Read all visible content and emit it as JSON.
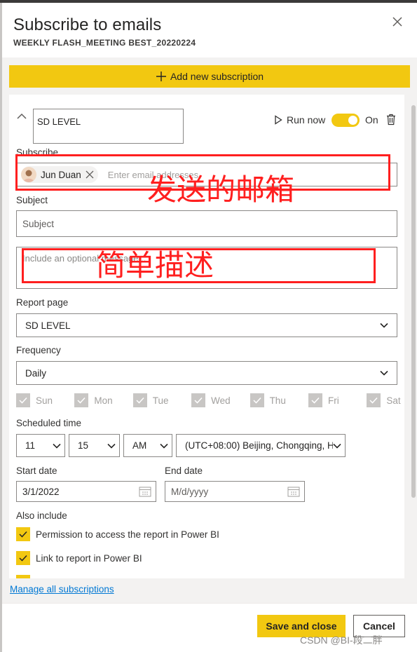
{
  "panel": {
    "title": "Subscribe to emails",
    "subtitle": "WEEKLY FLASH_MEETING BEST_20220224"
  },
  "add_subscription_label": "Add new subscription",
  "subscription": {
    "name": "SD LEVEL",
    "run_now_label": "Run now",
    "toggle_label": "On",
    "toggle_on": true,
    "subscribe_label": "Subscribe",
    "recipient_name": "Jun Duan",
    "email_placeholder": "Enter email addresses",
    "subject_label": "Subject",
    "subject_placeholder": "Subject",
    "message_placeholder": "Include an optional message...",
    "report_page_label": "Report page",
    "report_page_value": "SD LEVEL",
    "frequency_label": "Frequency",
    "frequency_value": "Daily",
    "days": [
      "Sun",
      "Mon",
      "Tue",
      "Wed",
      "Thu",
      "Fri",
      "Sat"
    ],
    "scheduled_time_label": "Scheduled time",
    "hour": "11",
    "minute": "15",
    "ampm": "AM",
    "timezone": "(UTC+08:00) Beijing, Chongqing, H",
    "start_date_label": "Start date",
    "start_date_value": "3/1/2022",
    "end_date_label": "End date",
    "end_date_placeholder": "M/d/yyyy",
    "also_include_label": "Also include",
    "include_options": [
      "Permission to access the report in Power BI",
      "Link to report in Power BI"
    ]
  },
  "manage_link": "Manage all subscriptions",
  "footer": {
    "save_label": "Save and close",
    "cancel_label": "Cancel"
  },
  "annotations": {
    "email_note": "发送的邮箱",
    "description_note": "简单描述"
  },
  "watermark": "CSDN @BI-段二胖",
  "colors": {
    "accent": "#f2c811",
    "annotation_red": "#ff1f1f",
    "link": "#0078d4"
  }
}
